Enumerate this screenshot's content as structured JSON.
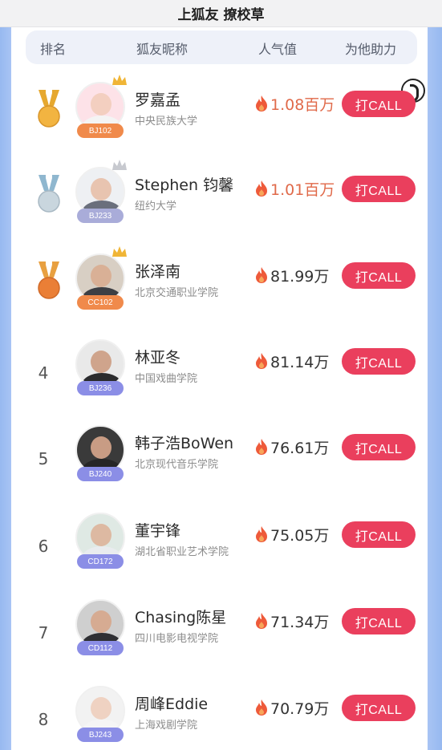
{
  "page": {
    "title": "上狐友 撩校草"
  },
  "header": {
    "rank_label": "排名",
    "name_label": "狐友昵称",
    "popularity_label": "人气值",
    "help_label": "为他助力"
  },
  "colors": {
    "call_button": "#ea3f5d",
    "top_popularity": "#e06a4a",
    "badge_orange": "#f08a4b",
    "badge_purple": "#8b8ee6",
    "badge_gray": "#a9acd9"
  },
  "rows": [
    {
      "rank": "1",
      "medal": "gold",
      "badge": "BJ102",
      "name": "罗嘉孟",
      "school": "中央民族大学",
      "popularity": "1.08百万",
      "call": "打CALL"
    },
    {
      "rank": "2",
      "medal": "silver",
      "badge": "BJ233",
      "name": "Stephen 钧馨",
      "school": "纽约大学",
      "popularity": "1.01百万",
      "call": "打CALL"
    },
    {
      "rank": "3",
      "medal": "bronze",
      "badge": "CC102",
      "name": "张泽南",
      "school": "北京交通职业学院",
      "popularity": "81.99万",
      "call": "打CALL"
    },
    {
      "rank": "4",
      "medal": "",
      "badge": "BJ236",
      "name": "林亚冬",
      "school": "中国戏曲学院",
      "popularity": "81.14万",
      "call": "打CALL"
    },
    {
      "rank": "5",
      "medal": "",
      "badge": "BJ240",
      "name": "韩子浩BoWen",
      "school": "北京现代音乐学院",
      "popularity": "76.61万",
      "call": "打CALL"
    },
    {
      "rank": "6",
      "medal": "",
      "badge": "CD172",
      "name": "董宇锋",
      "school": "湖北省职业艺术学院",
      "popularity": "75.05万",
      "call": "打CALL"
    },
    {
      "rank": "7",
      "medal": "",
      "badge": "CD112",
      "name": "Chasing陈星",
      "school": "四川电影电视学院",
      "popularity": "71.34万",
      "call": "打CALL"
    },
    {
      "rank": "8",
      "medal": "",
      "badge": "BJ243",
      "name": "周峰Eddie",
      "school": "上海戏剧学院",
      "popularity": "70.79万",
      "call": "打CALL"
    }
  ]
}
